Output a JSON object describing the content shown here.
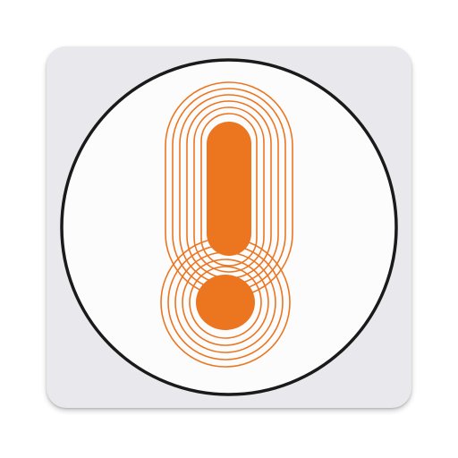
{
  "app_icon": {
    "icon": "exclamation-alert-icon",
    "colors": {
      "tile_background": "#e8e8ed",
      "disc_fill": "#fcfcfd",
      "disc_border": "#1a1a1a",
      "accent": "#ec7520"
    }
  }
}
